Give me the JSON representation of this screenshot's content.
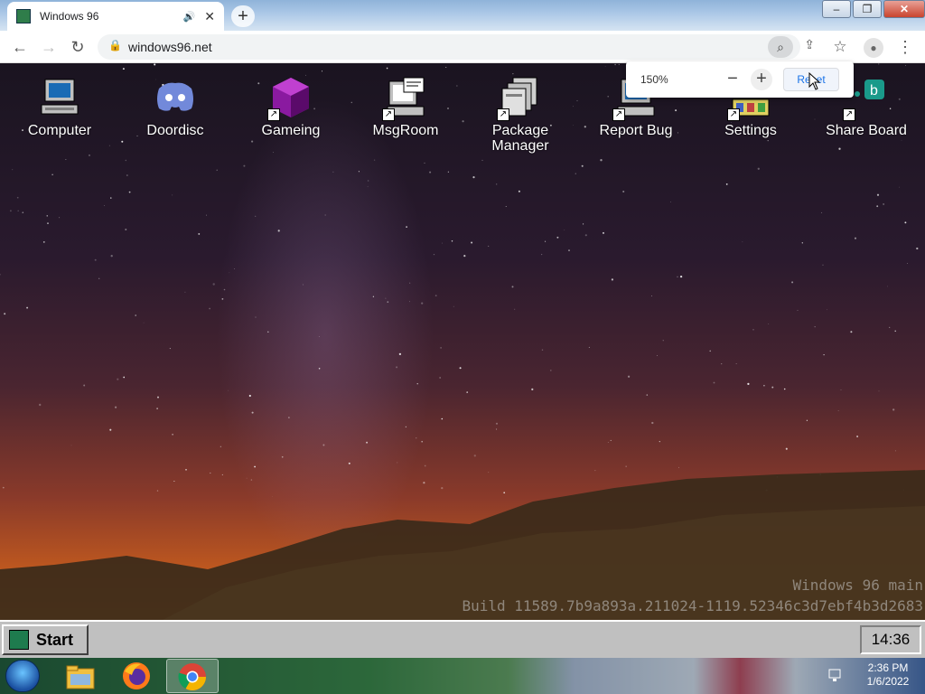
{
  "browser": {
    "tab_title": "Windows 96",
    "new_tab_glyph": "+",
    "url": "windows96.net",
    "window_controls": [
      "–",
      "❐",
      "✕"
    ]
  },
  "zoom_popup": {
    "percent": "150%",
    "minus": "−",
    "plus": "+",
    "reset": "Reset"
  },
  "desktop": {
    "icons": [
      {
        "label": "Computer",
        "icon": "computer-icon"
      },
      {
        "label": "Doordisc",
        "icon": "discord-icon"
      },
      {
        "label": "Gameing",
        "icon": "cube-icon"
      },
      {
        "label": "MsgRoom",
        "icon": "msgroom-icon"
      },
      {
        "label": "Package Manager",
        "icon": "package-icon"
      },
      {
        "label": "Report Bug",
        "icon": "bug-report-icon"
      },
      {
        "label": "Settings",
        "icon": "settings-icon"
      },
      {
        "label": "Share Board",
        "icon": "share-board-icon"
      }
    ],
    "build_line1": "Windows 96 main",
    "build_line2": "Build 11589.7b9a893a.211024-1119.52346c3d7ebf4b3d2683"
  },
  "w96_taskbar": {
    "start_label": "Start",
    "clock": "14:36"
  },
  "w7_taskbar": {
    "time": "2:36 PM",
    "date": "1/6/2022"
  },
  "colors": {
    "w96_gray": "#c0c0c0",
    "chrome_blue": "#1a73e8"
  }
}
